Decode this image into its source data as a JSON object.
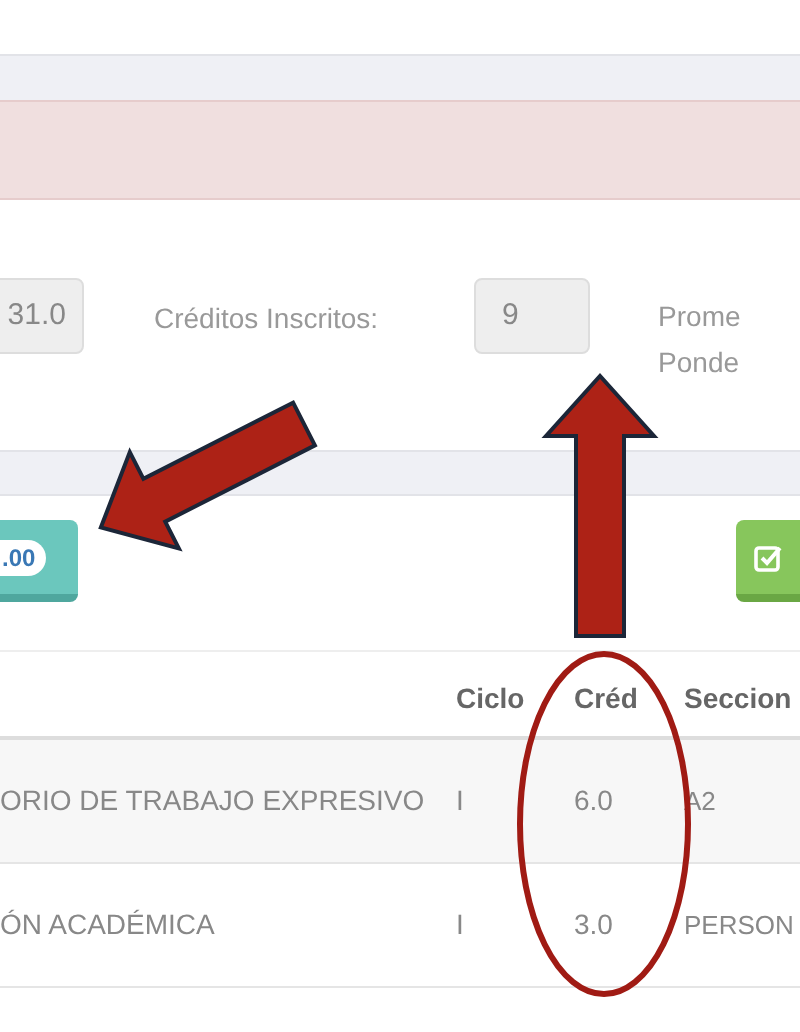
{
  "summary": {
    "first_value": "31.0",
    "credits_label": "Créditos Inscritos:",
    "credits_value": "9",
    "average_label": [
      "Prome",
      "Ponde"
    ]
  },
  "buttons": [
    {
      "kind": "badge",
      "badge": ".00"
    },
    {
      "kind": "check"
    }
  ],
  "table": {
    "columns": [
      "Ciclo",
      "Créd",
      "Seccion"
    ],
    "rows": [
      {
        "course": "ORIO DE TRABAJO EXPRESIVO",
        "cycle": "I",
        "credits": "6.0",
        "section": "A2"
      },
      {
        "course": "ÓN ACADÉMICA",
        "cycle": "I",
        "credits": "3.0",
        "section": "PERSON"
      }
    ]
  },
  "annotations": [
    {
      "kind": "arrow"
    },
    {
      "kind": "arrow"
    },
    {
      "kind": "ellipse"
    }
  ]
}
